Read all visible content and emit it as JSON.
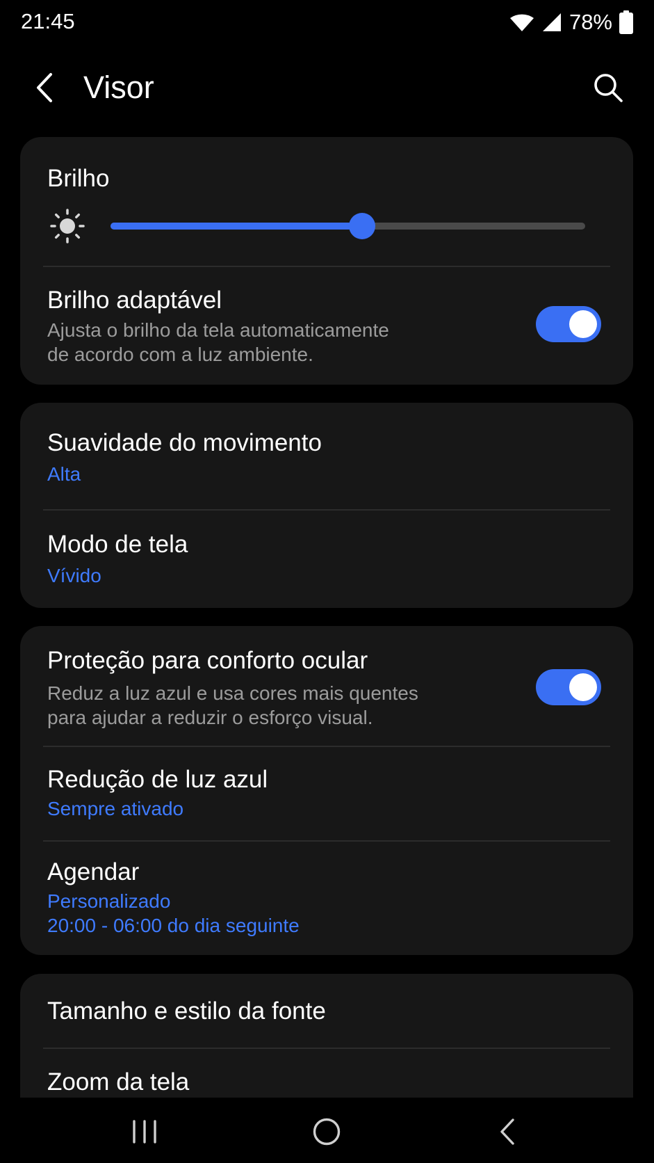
{
  "status_bar": {
    "time": "21:45",
    "battery_percent": "78%",
    "icons": [
      "wifi-icon",
      "signal-icon",
      "battery-icon"
    ]
  },
  "header": {
    "title": "Visor",
    "back_icon": "back-arrow-icon",
    "search_icon": "search-icon"
  },
  "brightness": {
    "title": "Brilho",
    "icon": "sun-icon",
    "level": 0.53
  },
  "adaptive_brightness": {
    "title": "Brilho adaptável",
    "description_line1": "Ajusta o brilho da tela automaticamente",
    "description_line2": "de acordo com a luz ambiente.",
    "enabled": true
  },
  "motion_smoothness": {
    "title": "Suavidade do movimento",
    "value": "Alta"
  },
  "screen_mode": {
    "title": "Modo de tela",
    "value": "Vívido"
  },
  "eye_comfort": {
    "title": "Proteção para conforto ocular",
    "description_line1": "Reduz a luz azul e usa cores mais quentes",
    "description_line2": "para ajudar a reduzir o esforço visual.",
    "enabled": true
  },
  "blue_light_reduction": {
    "title": "Redução de luz azul",
    "value": "Sempre ativado"
  },
  "schedule": {
    "title": "Agendar",
    "value_line1": "Personalizado",
    "value_line2": "20:00 - 06:00 do dia seguinte"
  },
  "font_size_style": {
    "title": "Tamanho e estilo da fonte"
  },
  "screen_zoom": {
    "title": "Zoom da tela"
  },
  "nav_bar": {
    "icons": [
      "recent-apps-icon",
      "home-icon",
      "back-icon"
    ]
  },
  "colors": {
    "background": "#000000",
    "card": "#171717",
    "accent": "#3a6ff3",
    "value_text": "#3f7bff",
    "secondary_text": "#9c9c9c"
  }
}
